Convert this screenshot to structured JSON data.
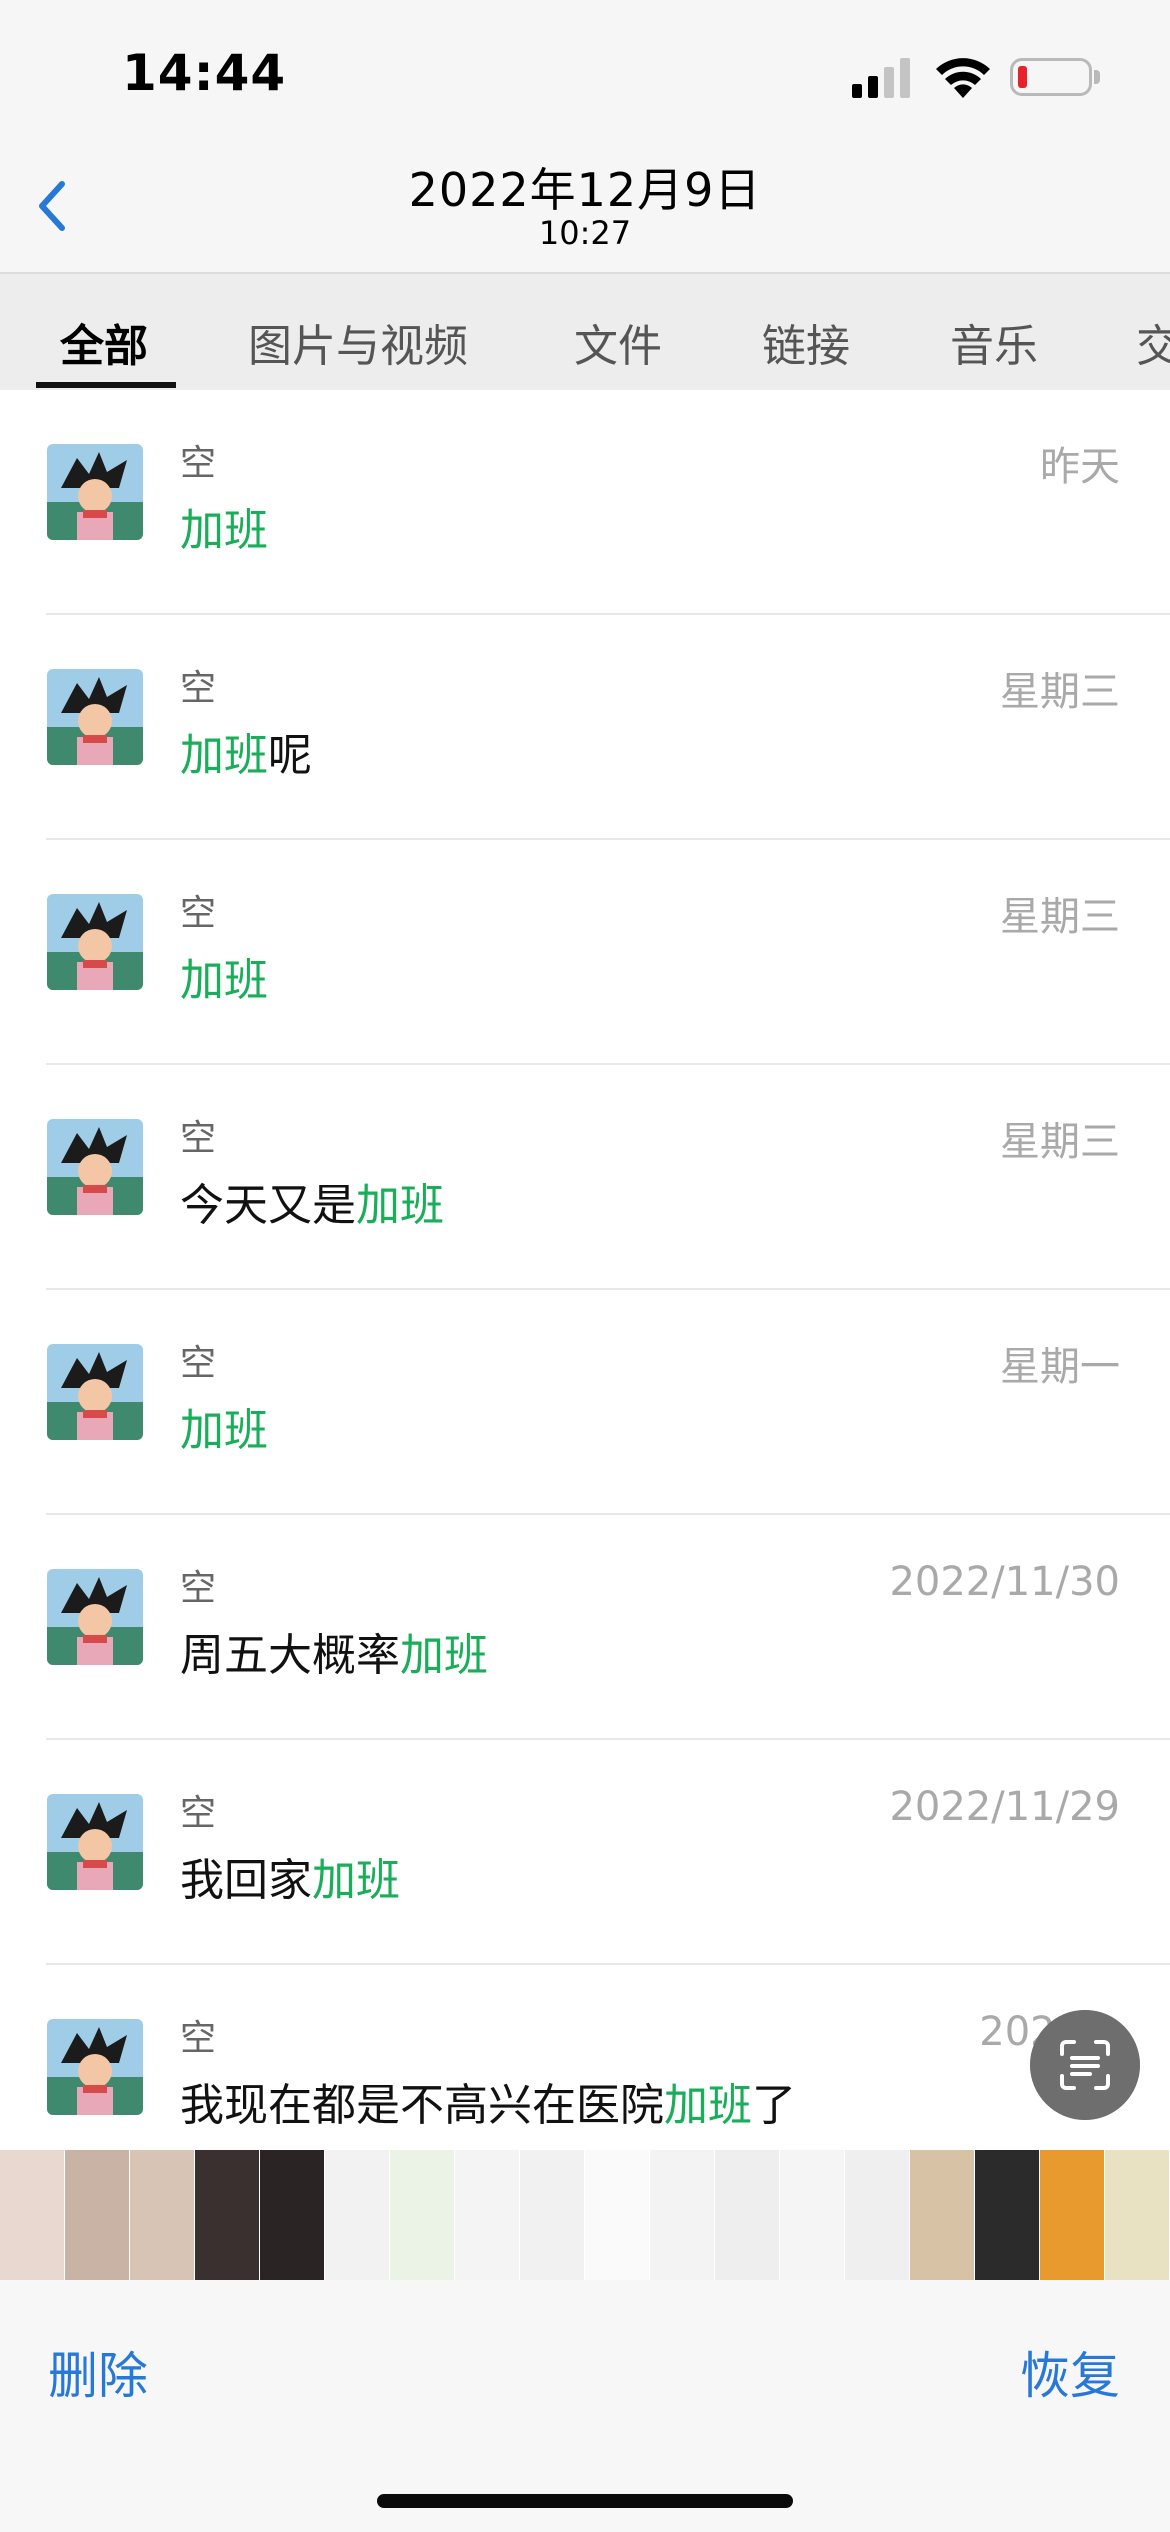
{
  "status": {
    "time": "14:44",
    "battery_color": "#e8222a"
  },
  "nav": {
    "title": "2022年12月9日",
    "subtitle": "10:27",
    "back_icon": "chevron-left-icon"
  },
  "tabs": [
    {
      "label": "全部",
      "active": true
    },
    {
      "label": "图片与视频",
      "active": false
    },
    {
      "label": "文件",
      "active": false
    },
    {
      "label": "链接",
      "active": false
    },
    {
      "label": "音乐",
      "active": false
    },
    {
      "label": "交",
      "active": false
    }
  ],
  "results": [
    {
      "sender": "空",
      "date": "昨天",
      "pre": "",
      "keyword": "加班",
      "post": ""
    },
    {
      "sender": "空",
      "date": "星期三",
      "pre": "",
      "keyword": "加班",
      "post": "呢"
    },
    {
      "sender": "空",
      "date": "星期三",
      "pre": "",
      "keyword": "加班",
      "post": ""
    },
    {
      "sender": "空",
      "date": "星期三",
      "pre": "今天又是",
      "keyword": "加班",
      "post": ""
    },
    {
      "sender": "空",
      "date": "星期一",
      "pre": "",
      "keyword": "加班",
      "post": ""
    },
    {
      "sender": "空",
      "date": "2022/11/30",
      "pre": "周五大概率",
      "keyword": "加班",
      "post": ""
    },
    {
      "sender": "空",
      "date": "2022/11/29",
      "pre": "我回家",
      "keyword": "加班",
      "post": ""
    },
    {
      "sender": "空",
      "date": "2022/1",
      "pre": "我现在都是不高兴在医院",
      "keyword": "加班",
      "post": "了"
    }
  ],
  "scan_icon": "scan-text-icon",
  "thumb_colors": [
    "#e9d8cf",
    "#c9b3a4",
    "#d8c4b5",
    "#3a3030",
    "#2a2424",
    "#f2f2f2",
    "#eaf3e6",
    "#f4f4f4",
    "#f1f1f1",
    "#fafafa",
    "#f3f3f3",
    "#eeeeee",
    "#f5f5f5",
    "#efefef",
    "#d7c2a6",
    "#2b2b2b",
    "#e99a2e",
    "#e8e1c2",
    "#f1e2ee",
    "#fafafa",
    "#f6f6f6",
    "#f4f4f4"
  ],
  "toolbar": {
    "delete_label": "删除",
    "restore_label": "恢复",
    "accent": "#2878d7"
  },
  "colors": {
    "highlight": "#1aad5a"
  }
}
